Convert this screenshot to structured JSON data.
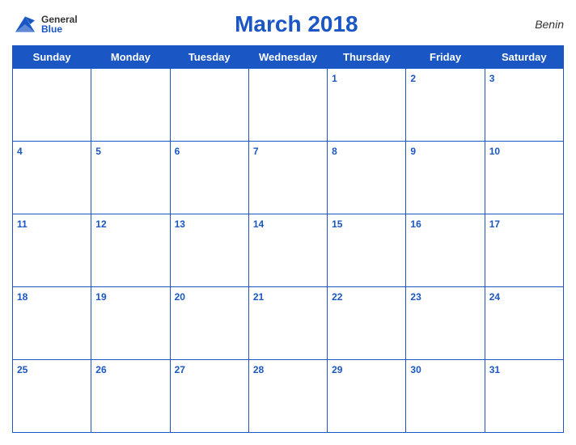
{
  "header": {
    "logo_general": "General",
    "logo_blue": "Blue",
    "title": "March 2018",
    "country": "Benin"
  },
  "days_of_week": [
    "Sunday",
    "Monday",
    "Tuesday",
    "Wednesday",
    "Thursday",
    "Friday",
    "Saturday"
  ],
  "weeks": [
    [
      null,
      null,
      null,
      null,
      1,
      2,
      3
    ],
    [
      4,
      5,
      6,
      7,
      8,
      9,
      10
    ],
    [
      11,
      12,
      13,
      14,
      15,
      16,
      17
    ],
    [
      18,
      19,
      20,
      21,
      22,
      23,
      24
    ],
    [
      25,
      26,
      27,
      28,
      29,
      30,
      31
    ]
  ]
}
